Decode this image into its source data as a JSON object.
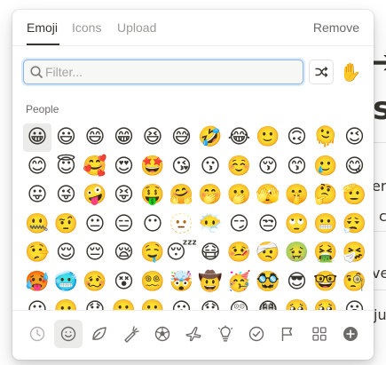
{
  "tabs": [
    {
      "label": "Emoji",
      "active": true
    },
    {
      "label": "Icons",
      "active": false
    },
    {
      "label": "Upload",
      "active": false
    }
  ],
  "remove_label": "Remove",
  "search": {
    "placeholder": "Filter..."
  },
  "skin_tone": "✋",
  "section_label": "People",
  "emoji_rows": [
    [
      "😀",
      "😃",
      "😄",
      "😁",
      "😆",
      "😅",
      "🤣",
      "😂",
      "🙂",
      "🙃",
      "🫠",
      "😉"
    ],
    [
      "😊",
      "😇",
      "🥰",
      "😍",
      "🤩",
      "😘",
      "😗",
      "☺️",
      "😚",
      "😙",
      "🥲",
      "😋"
    ],
    [
      "😛",
      "😜",
      "🤪",
      "😝",
      "🤑",
      "🤗",
      "🤭",
      "🫢",
      "🫣",
      "🤫",
      "🤔",
      "🫡"
    ],
    [
      "🤐",
      "🤨",
      "😐",
      "😑",
      "😶",
      "🫥",
      "😶‍🌫️",
      "😏",
      "😒",
      "🙄",
      "😬",
      "😮‍💨"
    ],
    [
      "🤥",
      "😌",
      "😔",
      "😪",
      "🤤",
      "😴",
      "😷",
      "🤒",
      "🤕",
      "🤢",
      "🤮",
      "🤧"
    ],
    [
      "🥵",
      "🥶",
      "🥴",
      "😵",
      "😵‍💫",
      "🤯",
      "🤠",
      "🥳",
      "🥸",
      "😎",
      "🤓",
      "🧐"
    ],
    [
      "😕",
      "🫤",
      "😟",
      "🙁",
      "☹️",
      "😮",
      "😯",
      "😲",
      "😳",
      "🥺",
      "🥹",
      "😦"
    ]
  ],
  "categories": [
    {
      "icon": "clock-icon",
      "active": false
    },
    {
      "icon": "smiley-icon",
      "active": true
    },
    {
      "icon": "leaf-icon",
      "active": false
    },
    {
      "icon": "carrot-icon",
      "active": false
    },
    {
      "icon": "soccer-ball-icon",
      "active": false
    },
    {
      "icon": "airplane-icon",
      "active": false
    },
    {
      "icon": "lightbulb-icon",
      "active": false
    },
    {
      "icon": "check-circle-icon",
      "active": false
    },
    {
      "icon": "flag-icon",
      "active": false
    },
    {
      "icon": "grid-icon",
      "active": false
    },
    {
      "icon": "plus-circle-icon",
      "active": false
    }
  ],
  "background_fragments": {
    "arrow": "➔",
    "big_letter": "s",
    "frag_er": "er",
    "frag_c": "c",
    "frag_ve": "ve",
    "frag_ju": "ju"
  },
  "colors": {
    "accent_focus": "#8fb7e6",
    "text": "#37352f",
    "muted": "#9b9a97",
    "hover_bg": "#ebebea"
  }
}
